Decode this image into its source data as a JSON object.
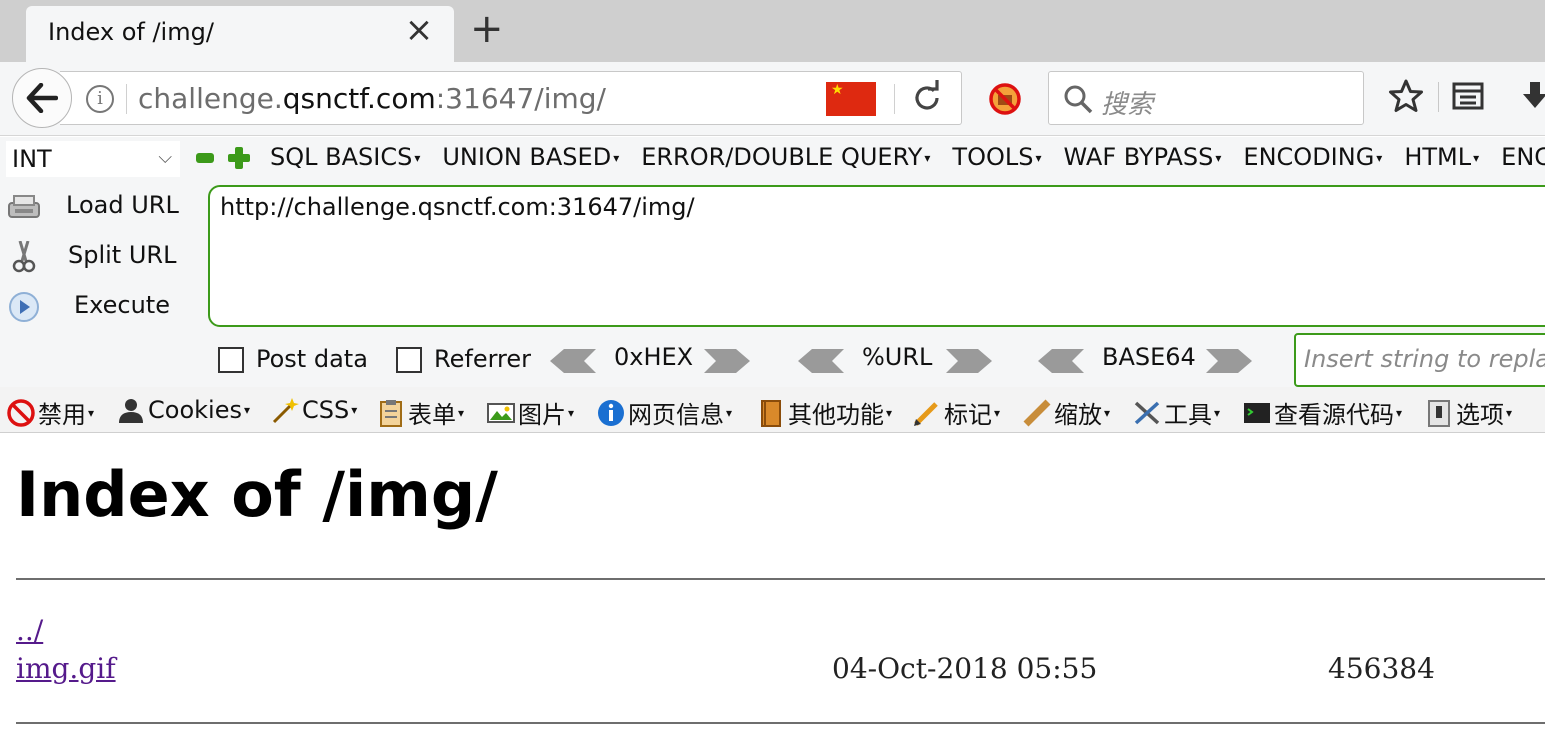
{
  "tab": {
    "title": "Index of /img/",
    "close": "×",
    "new_tab": "+"
  },
  "navbar": {
    "url_prefix": "challenge.",
    "url_domain": "qsnctf.com",
    "url_suffix": ":31647/img/",
    "search_placeholder": "搜索"
  },
  "hackbar": {
    "type_select": "INT",
    "menus": [
      "SQL BASICS",
      "UNION BASED",
      "ERROR/DOUBLE QUERY",
      "TOOLS",
      "WAF BYPASS",
      "ENCODING",
      "HTML",
      "ENC"
    ],
    "load_url": "Load URL",
    "split_url": "Split URL",
    "execute": "Execute",
    "url_value": "http://challenge.qsnctf.com:31647/img/",
    "post_data": "Post data",
    "referrer": "Referrer",
    "hex": "0xHEX",
    "urlenc": "%URL",
    "base64": "BASE64",
    "replace_placeholder": "Insert string to replac"
  },
  "devbar": {
    "items": [
      "禁用",
      "Cookies",
      "CSS",
      "表单",
      "图片",
      "网页信息",
      "其他功能",
      "标记",
      "缩放",
      "工具",
      "查看源代码",
      "选项"
    ]
  },
  "page": {
    "heading": "Index of /img/",
    "entries": [
      {
        "name": "../",
        "date": "",
        "size": ""
      },
      {
        "name": "img.gif",
        "date": "04-Oct-2018 05:55",
        "size": "456384"
      }
    ]
  },
  "colors": {
    "accent_green": "#3c9a1a",
    "link": "#551a8b",
    "flag_red": "#de2910"
  }
}
